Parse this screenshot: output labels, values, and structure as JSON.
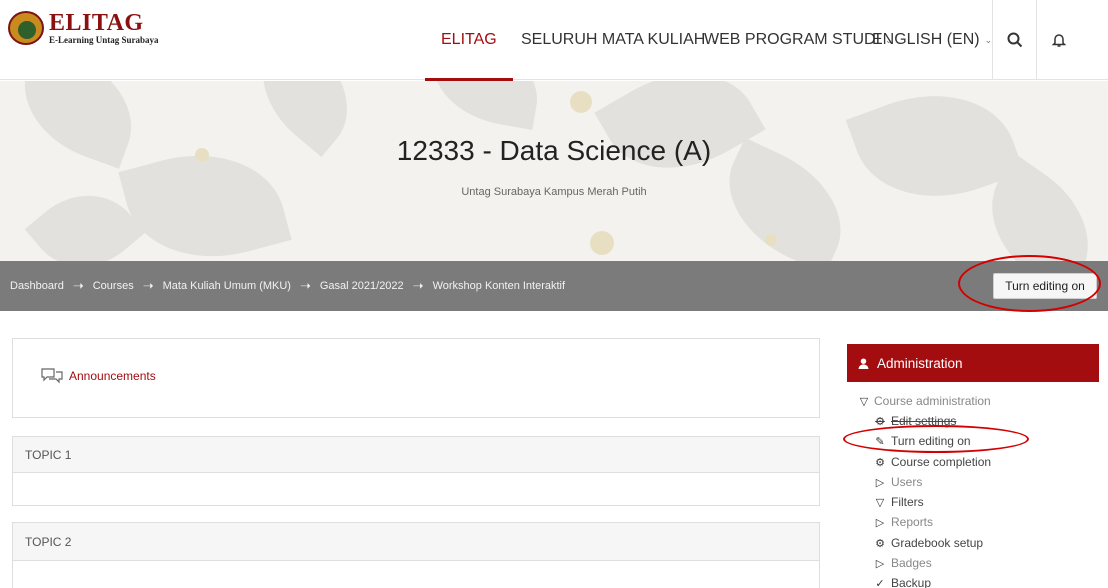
{
  "header": {
    "logo_title": "ELITAG",
    "logo_subtitle": "E-Learning Untag Surabaya",
    "nav": [
      {
        "label": "ELITAG",
        "active": true
      },
      {
        "label": "SELURUH MATA KULIAH",
        "dropdown": true
      },
      {
        "label": "WEB PROGRAM STUDI",
        "dropdown": true
      },
      {
        "label": "ENGLISH (EN)",
        "dropdown": true
      }
    ],
    "icons": [
      "search-icon",
      "bell-icon"
    ]
  },
  "course": {
    "title": "12333 - Data Science (A)",
    "subtitle": "Untag Surabaya Kampus Merah Putih"
  },
  "breadcrumb": [
    "Dashboard",
    "Courses",
    "Mata Kuliah Umum (MKU)",
    "Gasal 2021/2022",
    "Workshop Konten Interaktif"
  ],
  "edit_button_label": "Turn editing on",
  "main": {
    "announcements": "Announcements",
    "topics": [
      "TOPIC 1",
      "TOPIC 2"
    ]
  },
  "admin": {
    "title": "Administration",
    "section": "Course administration",
    "items": [
      {
        "label": "Edit settings",
        "icon": "gear-icon"
      },
      {
        "label": "Turn editing on",
        "icon": "pencil-icon"
      },
      {
        "label": "Course completion",
        "icon": "gear-icon"
      },
      {
        "label": "Users",
        "icon": "triangle-right-icon"
      },
      {
        "label": "Filters",
        "icon": "filter-icon"
      },
      {
        "label": "Reports",
        "icon": "triangle-right-icon"
      },
      {
        "label": "Gradebook setup",
        "icon": "gear-icon"
      },
      {
        "label": "Badges",
        "icon": "triangle-right-icon"
      },
      {
        "label": "Backup",
        "icon": "backup-icon"
      }
    ]
  },
  "colors": {
    "brand": "#a30d10",
    "breadcrumb_bg": "#7b7b7b",
    "highlight": "#d40000"
  }
}
